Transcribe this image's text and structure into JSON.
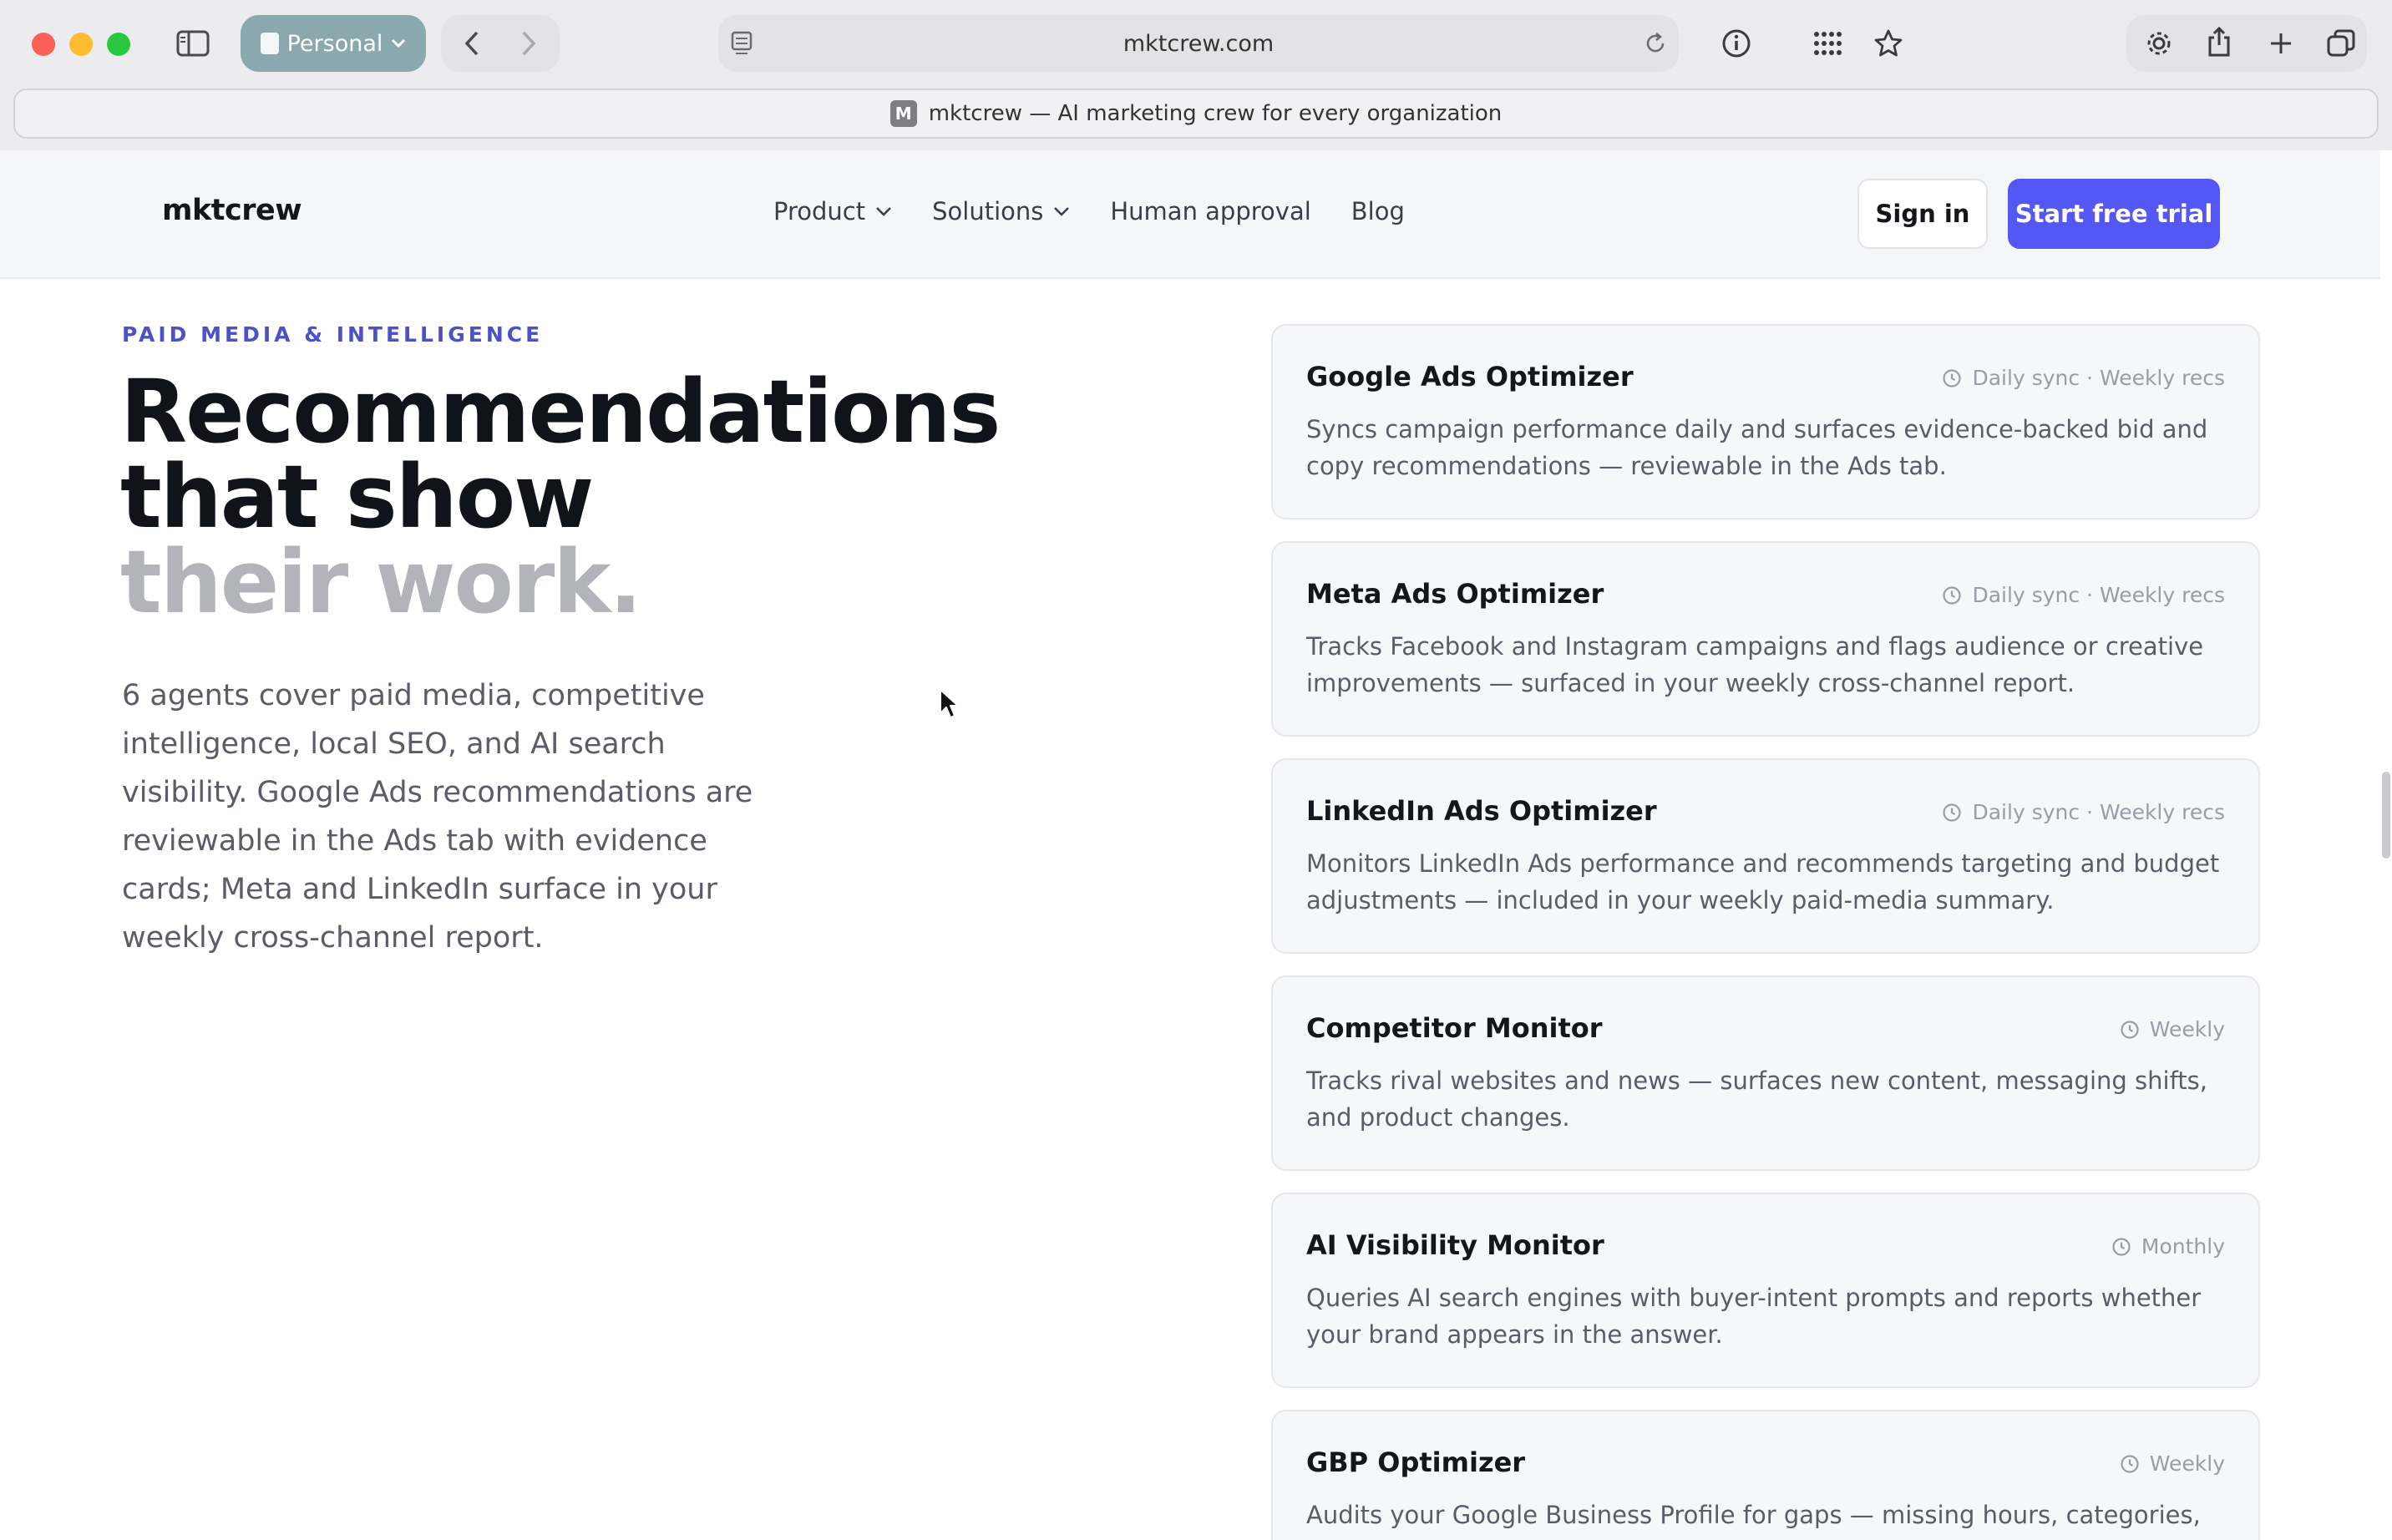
{
  "browser": {
    "profile_label": "Personal",
    "address": "mktcrew.com",
    "tab_favicon_letter": "M",
    "tab_title": "mktcrew — AI marketing crew for every organization"
  },
  "site": {
    "logo": "mktcrew",
    "nav": {
      "product": "Product",
      "solutions": "Solutions",
      "human_approval": "Human approval",
      "blog": "Blog"
    },
    "signin": "Sign in",
    "trial": "Start free trial",
    "accent": "#5457f4"
  },
  "hero": {
    "eyebrow": "PAID MEDIA & INTELLIGENCE",
    "headline_line1": "Recommendations",
    "headline_line2": "that show",
    "headline_line3": "their work.",
    "lede": "6 agents cover paid media, competitive intelligence, local SEO, and AI search visibility. Google Ads recommendations are reviewable in the Ads tab with evidence cards; Meta and LinkedIn surface in your weekly cross-channel report."
  },
  "cards": [
    {
      "title": "Google Ads Optimizer",
      "cadence": "Daily sync · Weekly recs",
      "desc": "Syncs campaign performance daily and surfaces evidence-backed bid and copy recommendations — reviewable in the Ads tab."
    },
    {
      "title": "Meta Ads Optimizer",
      "cadence": "Daily sync · Weekly recs",
      "desc": "Tracks Facebook and Instagram campaigns and flags audience or creative improvements — surfaced in your weekly cross-channel report."
    },
    {
      "title": "LinkedIn Ads Optimizer",
      "cadence": "Daily sync · Weekly recs",
      "desc": "Monitors LinkedIn Ads performance and recommends targeting and budget adjustments — included in your weekly paid-media summary."
    },
    {
      "title": "Competitor Monitor",
      "cadence": "Weekly",
      "desc": "Tracks rival websites and news — surfaces new content, messaging shifts, and product changes."
    },
    {
      "title": "AI Visibility Monitor",
      "cadence": "Monthly",
      "desc": "Queries AI search engines with buyer-intent prompts and reports whether your brand appears in the answer."
    },
    {
      "title": "GBP Optimizer",
      "cadence": "Weekly",
      "desc": "Audits your Google Business Profile for gaps — missing hours, categories, photos —"
    }
  ]
}
